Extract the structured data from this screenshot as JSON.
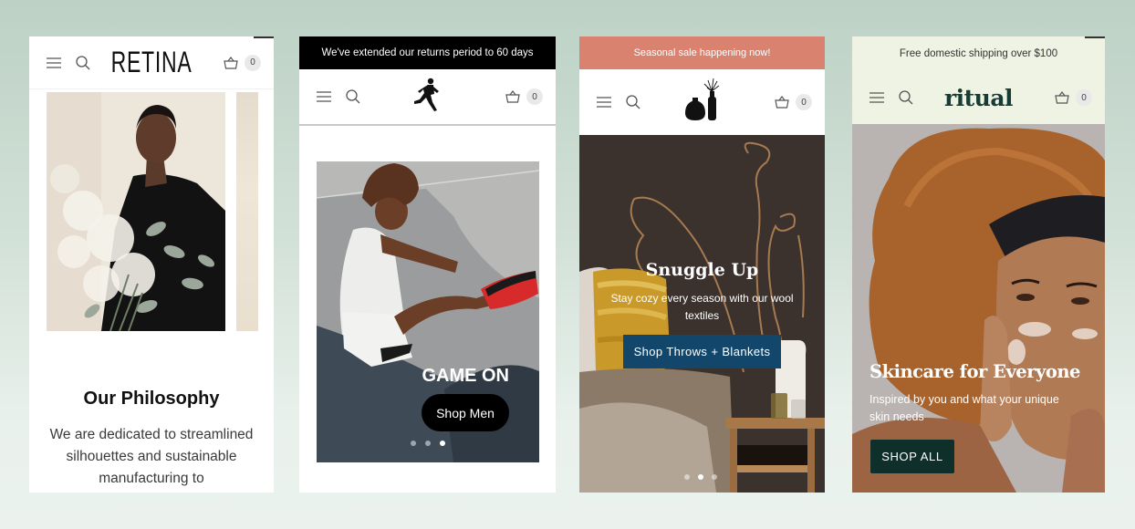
{
  "phones": [
    {
      "brand": "RETINA",
      "cart_count": "0",
      "section_title": "Our Philosophy",
      "section_body": "We are dedicated to streamlined silhouettes and sustainable manufacturing to",
      "hero_image": "woman holding white flower bouquet"
    },
    {
      "announcement": "We've extended our returns period to 60 days",
      "brand_logo": "running-man-logo",
      "cart_count": "0",
      "slide_heading": "GAME ON",
      "slide_cta": "Shop Men",
      "slide_count": 3,
      "active_slide": 3,
      "hero_image": "young man sitting on court tying red sneaker"
    },
    {
      "announcement": "Seasonal sale happening now!",
      "brand_logo": "vases-logo",
      "cart_count": "0",
      "hero_title": "Snuggle Up",
      "hero_subtitle": "Stay cozy every season with our wool textiles",
      "hero_cta": "Shop Throws + Blankets",
      "slide_count": 3,
      "active_slide": 2,
      "hero_image": "yellow woven pillow and dried branches",
      "colors": {
        "announcement_bg": "#d98270",
        "cta_bg": "#12476b"
      }
    },
    {
      "announcement": "Free domestic shipping over $100",
      "brand": "ritual",
      "cart_count": "0",
      "hero_title": "Skincare for Everyone",
      "hero_subtitle": "Inspired by you and what your unique skin needs",
      "hero_cta": "SHOP ALL",
      "hero_image": "woman with curly hair applying face cleanser",
      "colors": {
        "header_bg": "#eef3e3",
        "brand": "#173c35",
        "cta_bg": "#0e2f2a"
      }
    }
  ]
}
